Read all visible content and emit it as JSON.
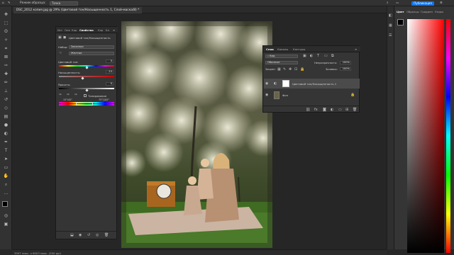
{
  "options_bar": {
    "mode_label": "Режим образца:",
    "mode_value": "Точка",
    "share_label": "Публикация"
  },
  "document": {
    "tab_title": "DSC_2012 копия.jpg @ 29% (Цветовой тон/Насыщенность 1, Слой-маска/8) *"
  },
  "status_bar": {
    "text": "3997 пикс. x 6003 пикс. (300 ppi)"
  },
  "properties_panel": {
    "tabs": [
      "Ист",
      "Опе",
      "Кор",
      "Свойства",
      "Кэр",
      "Бл"
    ],
    "active_tab": "Свойства",
    "adjustment_title": "Цветовой тон/Насыщенность",
    "preset_label": "Набор:",
    "preset_value": "Заказная",
    "channel_value": "Желтые",
    "hue_label": "Цветовой тон:",
    "hue_value": "0",
    "hue_fraction": 0.5,
    "saturation_label": "Насыщенность:",
    "saturation_value": "-15",
    "saturation_fraction": 0.43,
    "lightness_label": "Яркость:",
    "lightness_value": "0",
    "lightness_fraction": 0.5,
    "colorize_label": "Тонирование",
    "range_left": "15°/45°",
    "range_right": "75°/105°"
  },
  "layers_panel": {
    "tabs": [
      "Слои",
      "Каналы",
      "Контуры"
    ],
    "active_tab": "Слои",
    "filter_label": "Вид",
    "blend_mode": "Обычные",
    "opacity_label": "Непрозрачность:",
    "opacity_value": "100%",
    "lock_label": "Закреп:",
    "fill_label": "Заливка:",
    "fill_value": "100%",
    "layers": [
      {
        "name": "Цветовой тон/Насыщенность 1",
        "selected": true
      },
      {
        "name": "Фон",
        "selected": false
      }
    ]
  },
  "color_panel": {
    "tabs": [
      "Цвет",
      "Образцы",
      "Градиен",
      "Узоры"
    ],
    "active_tab": "Цвет",
    "hue_color": "#ff0000"
  },
  "tools": [
    "move-icon",
    "marquee-icon",
    "lasso-icon",
    "quick-select-icon",
    "crop-icon",
    "frame-icon",
    "eyedropper-icon",
    "healing-icon",
    "brush-icon",
    "stamp-icon",
    "history-brush-icon",
    "eraser-icon",
    "gradient-icon",
    "blur-icon",
    "dodge-icon",
    "pen-icon",
    "type-icon",
    "path-select-icon",
    "rectangle-icon",
    "hand-icon",
    "zoom-icon",
    "more-tools-icon"
  ]
}
